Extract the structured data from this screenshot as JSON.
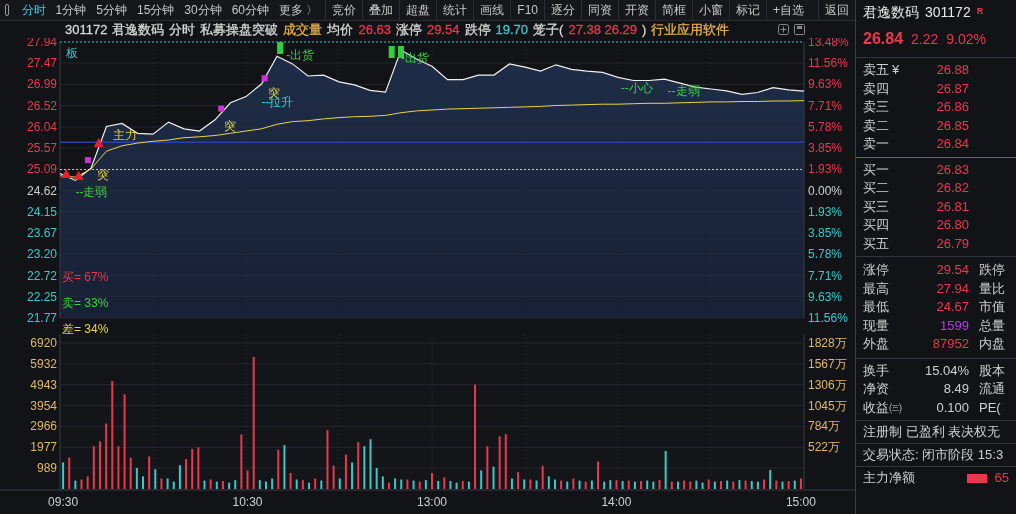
{
  "toolbar": {
    "tabs": [
      {
        "label": "分时",
        "selected": true
      },
      {
        "label": "1分钟",
        "selected": false
      },
      {
        "label": "5分钟",
        "selected": false
      },
      {
        "label": "15分钟",
        "selected": false
      },
      {
        "label": "30分钟",
        "selected": false
      },
      {
        "label": "60分钟",
        "selected": false
      },
      {
        "label": "更多 〉",
        "selected": false
      }
    ],
    "buttons": [
      "竞价",
      "叠加",
      "超盘",
      "统计",
      "画线",
      "F10",
      "逐分",
      "同资",
      "开资",
      "简框",
      "小窗",
      "标记",
      "+自选",
      "返回"
    ]
  },
  "info_line": [
    {
      "text": "301172"
    },
    {
      "text": "君逸数码"
    },
    {
      "text": "分时"
    },
    {
      "text": "私募操盘突破"
    },
    {
      "text": "成交量",
      "color": "#e8b04a"
    },
    {
      "text": "均价"
    },
    {
      "text": "26.63",
      "color": "#e8394d"
    },
    {
      "text": "涨停"
    },
    {
      "text": "29.54",
      "color": "#e8394d"
    },
    {
      "text": "跌停"
    },
    {
      "text": "19.70",
      "color": "#3cc8c8"
    },
    {
      "text": "笼子("
    },
    {
      "text": "27.38 26.29",
      "color": "#e8394d"
    },
    {
      "text": ")"
    },
    {
      "text": "行业应用软件",
      "color": "#e8b04a"
    }
  ],
  "price_chart": {
    "chart_data": {
      "type": "line",
      "grid": true,
      "ylim": [
        21.77,
        27.94
      ],
      "ref_lines": [
        {
          "axis": "y",
          "value": 27.94,
          "color": "#3cc8c8"
        },
        {
          "axis": "y",
          "value": 25.09,
          "color": "#c8c8c8"
        },
        {
          "axis": "y",
          "value": 25.7,
          "color": "#2a3fa8"
        }
      ],
      "categories": [
        null,
        null,
        null,
        null,
        null,
        null,
        null,
        null,
        null,
        null,
        null,
        null,
        null,
        null,
        null,
        null,
        null,
        null,
        null,
        null,
        null,
        null,
        null,
        null,
        null,
        null,
        null,
        null,
        null,
        null,
        null,
        null,
        null,
        null,
        null,
        null,
        null,
        null,
        null,
        null,
        null,
        null,
        null,
        null,
        null,
        null,
        null,
        null,
        null
      ],
      "yticks": [
        27.94,
        27.47,
        26.99,
        26.52,
        26.04,
        25.57,
        25.09,
        24.62,
        24.15,
        23.67,
        {
          "value": 23.2,
          "label": "23.20"
        },
        22.72,
        22.25,
        21.77
      ],
      "series": [
        {
          "color": "#f0f0f0",
          "values": [
            25.0,
            24.85,
            25.12,
            26.05,
            26.12,
            25.9,
            25.88,
            26.15,
            26.0,
            25.95,
            26.2,
            26.58,
            26.72,
            27.0,
            27.62,
            27.45,
            27.18,
            27.2,
            27.05,
            26.98,
            26.86,
            26.82,
            27.76,
            27.56,
            27.4,
            27.1,
            27.1,
            27.2,
            27.2,
            27.45,
            27.38,
            27.29,
            27.43,
            27.33,
            27.29,
            27.26,
            27.15,
            27.08,
            27.08,
            27.11,
            27.02,
            26.93,
            26.89,
            26.85,
            26.77,
            26.81,
            26.92,
            26.87,
            26.84
          ]
        },
        {
          "color": "#e8d44a",
          "values": [
            24.95,
            24.92,
            25.1,
            25.5,
            25.62,
            25.68,
            25.72,
            25.75,
            25.8,
            25.82,
            25.85,
            25.9,
            25.95,
            26.0,
            26.1,
            26.16,
            26.18,
            26.22,
            26.25,
            26.27,
            26.28,
            26.3,
            26.36,
            26.4,
            26.42,
            26.44,
            26.45,
            26.46,
            26.47,
            26.48,
            26.49,
            26.5,
            26.52,
            26.53,
            26.54,
            26.55,
            26.55,
            26.56,
            26.57,
            26.57,
            26.58,
            26.59,
            26.6,
            26.6,
            26.61,
            26.61,
            26.62,
            26.62,
            26.63
          ]
        }
      ],
      "annotations": [
        "板",
        "突",
        "--走弱",
        "主力",
        "突",
        "突",
        "--拉升",
        "-出货",
        "-出货",
        "--小心",
        "--走弱"
      ]
    },
    "right_axis": [
      {
        "label": "13.48%",
        "color": "#e8394d"
      },
      {
        "label": "11.56%",
        "color": "#e8394d"
      },
      {
        "label": "9.63%",
        "color": "#e8394d"
      },
      {
        "label": "7.71%",
        "color": "#e8394d"
      },
      {
        "label": "5.78%",
        "color": "#e8394d"
      },
      {
        "label": "3.85%",
        "color": "#e8394d"
      },
      {
        "label": "1.93%",
        "color": "#e8394d"
      },
      {
        "label": "0.00%",
        "color": "#d0d0d0"
      },
      {
        "label": "1.93%",
        "color": "#3cc8c8"
      },
      {
        "label": "3.85%",
        "color": "#3cc8c8"
      },
      {
        "label": "5.78%",
        "color": "#3cc8c8"
      },
      {
        "label": "7.71%",
        "color": "#3cc8c8"
      },
      {
        "label": "9.63%",
        "color": "#3cc8c8"
      },
      {
        "label": "11.56%",
        "color": "#3cc8c8"
      }
    ],
    "ratios": [
      {
        "text": "买= 67%",
        "color": "#e8394d"
      },
      {
        "text": "卖= 33%",
        "color": "#3cd040"
      },
      {
        "text": "差= 34%",
        "color": "#e8d44a"
      }
    ]
  },
  "volume_chart": {
    "chart_data": {
      "type": "bar",
      "stacked": true,
      "grid": true,
      "ylim": [
        0,
        6920
      ],
      "categories": [
        "09:30",
        null,
        null,
        null,
        null,
        null,
        null,
        null,
        null,
        null,
        null,
        null,
        null,
        null,
        null,
        null,
        null,
        null,
        null,
        null,
        null,
        null,
        null,
        null,
        null,
        null,
        null,
        null,
        null,
        null,
        "10:30",
        null,
        null,
        null,
        null,
        null,
        null,
        null,
        null,
        null,
        null,
        null,
        null,
        null,
        null,
        null,
        null,
        null,
        null,
        null,
        null,
        null,
        null,
        null,
        null,
        null,
        null,
        null,
        null,
        null,
        "13:00",
        null,
        null,
        null,
        null,
        null,
        null,
        null,
        null,
        null,
        null,
        null,
        null,
        null,
        null,
        null,
        null,
        null,
        null,
        null,
        null,
        null,
        null,
        null,
        null,
        null,
        null,
        null,
        null,
        null,
        "14:00",
        null,
        null,
        null,
        null,
        null,
        null,
        null,
        null,
        null,
        null,
        null,
        null,
        null,
        null,
        null,
        null,
        null,
        null,
        null,
        null,
        null,
        null,
        null,
        null,
        null,
        null,
        null,
        null,
        null,
        "15:00"
      ],
      "yticks": [
        6920,
        5932,
        4943,
        3954,
        2966,
        1977,
        989
      ],
      "series": [
        {
          "color": "#e8394d",
          "values": [
            null,
            1490,
            null,
            450,
            600,
            2030,
            2260,
            3100,
            5120,
            2030,
            4490,
            1490,
            null,
            null,
            1540,
            null,
            500,
            null,
            null,
            null,
            1420,
            1900,
            1980,
            null,
            450,
            null,
            380,
            null,
            null,
            2590,
            880,
            6260,
            null,
            null,
            null,
            1860,
            null,
            760,
            null,
            420,
            null,
            500,
            null,
            2790,
            1110,
            null,
            1630,
            null,
            2220,
            null,
            null,
            null,
            null,
            300,
            null,
            null,
            450,
            null,
            350,
            null,
            760,
            null,
            550,
            null,
            null,
            380,
            null,
            4950,
            null,
            2030,
            null,
            2500,
            2600,
            null,
            800,
            null,
            450,
            null,
            1100,
            null,
            null,
            400,
            null,
            500,
            null,
            350,
            null,
            1300,
            null,
            null,
            420,
            null,
            400,
            null,
            380,
            null,
            null,
            420,
            null,
            350,
            null,
            400,
            350,
            null,
            null,
            450,
            null,
            380,
            null,
            350,
            null,
            400,
            null,
            null,
            450,
            null,
            400,
            null,
            380,
            null,
            500
          ]
        },
        {
          "color": "#3cc8c8",
          "values": [
            1260,
            null,
            400,
            null,
            null,
            null,
            null,
            null,
            null,
            null,
            null,
            null,
            1000,
            600,
            null,
            940,
            null,
            500,
            350,
            1130,
            null,
            null,
            null,
            400,
            null,
            350,
            null,
            300,
            420,
            null,
            null,
            null,
            420,
            350,
            500,
            null,
            2080,
            null,
            450,
            null,
            300,
            null,
            400,
            null,
            null,
            500,
            null,
            1260,
            null,
            2030,
            2360,
            1000,
            600,
            null,
            500,
            450,
            null,
            400,
            null,
            420,
            null,
            380,
            null,
            380,
            300,
            null,
            350,
            null,
            880,
            null,
            1060,
            null,
            null,
            500,
            null,
            450,
            null,
            400,
            null,
            600,
            450,
            null,
            350,
            null,
            400,
            null,
            400,
            null,
            350,
            420,
            null,
            380,
            null,
            350,
            null,
            400,
            350,
            null,
            1800,
            null,
            350,
            null,
            null,
            400,
            300,
            null,
            350,
            null,
            400,
            null,
            420,
            null,
            380,
            350,
            null,
            900,
            null,
            350,
            null,
            400,
            null
          ]
        }
      ]
    },
    "right_axis": [
      "1828万",
      "1567万",
      "1306万",
      "1045万",
      "784万",
      "522万"
    ]
  },
  "quote": {
    "name": "君逸数码",
    "code": "301172",
    "badge": "R",
    "price": "26.84",
    "change": "2.22",
    "change_pct": "9.02%",
    "asks": [
      {
        "label": "卖五",
        "currency": "¥",
        "price": "26.88"
      },
      {
        "label": "卖四",
        "price": "26.87"
      },
      {
        "label": "卖三",
        "price": "26.86"
      },
      {
        "label": "卖二",
        "price": "26.85"
      },
      {
        "label": "卖一",
        "price": "26.84"
      }
    ],
    "bids": [
      {
        "label": "买一",
        "price": "26.83"
      },
      {
        "label": "买二",
        "price": "26.82"
      },
      {
        "label": "买三",
        "price": "26.81"
      },
      {
        "label": "买四",
        "price": "26.80"
      },
      {
        "label": "买五",
        "price": "26.79"
      }
    ],
    "stats": [
      {
        "label": "涨停",
        "value": "29.54",
        "color": "#e8394d",
        "label2": "跌停"
      },
      {
        "label": "最高",
        "value": "27.94",
        "color": "#e8394d",
        "label2": "量比"
      },
      {
        "label": "最低",
        "value": "24.67",
        "color": "#e8394d",
        "label2": "市值"
      },
      {
        "label": "现量",
        "value": "1599",
        "color": "#b040e0",
        "label2": "总量"
      },
      {
        "label": "外盘",
        "value": "87952",
        "color": "#e8394d",
        "label2": "内盘"
      }
    ],
    "fundamentals": [
      {
        "label": "换手",
        "value": "15.04%",
        "label2": "股本"
      },
      {
        "label": "净资",
        "value": "8.49",
        "label2": "流通"
      },
      {
        "label": "收益㈢",
        "value": "0.100",
        "label2": "PE("
      }
    ],
    "tags": "注册制 已盈利 表决权无",
    "trade_status": "交易状态: 闭市阶段 15:3",
    "main_net": {
      "label": "主力净额",
      "value": "65"
    }
  }
}
